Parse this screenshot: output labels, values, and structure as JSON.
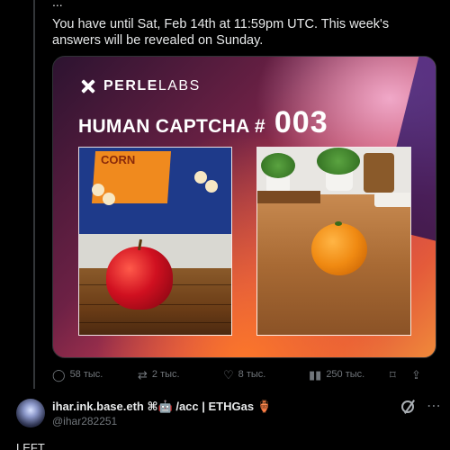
{
  "post": {
    "clipped_line": "...",
    "text": "You have until Sat, Feb 14th at 11:59pm UTC. This week's answers will be revealed on Sunday."
  },
  "card": {
    "brand_bold": "PERLE",
    "brand_light": "LABS",
    "title": "HUMAN CAPTCHA #",
    "number": "003",
    "left_photo_poster_text": "CORN"
  },
  "actions": {
    "replies": "58 тыс.",
    "reposts": "2 тыс.",
    "likes": "8 тыс.",
    "views": "250 тыс."
  },
  "reply": {
    "name": "ihar.ink.base.eth ⌘🤖 /acc | ETHGas 🏺",
    "handle": "@ihar282251",
    "text": "LEFT"
  },
  "colors": {
    "background": "#000000",
    "text": "#e7e9ea",
    "muted": "#71767b"
  }
}
